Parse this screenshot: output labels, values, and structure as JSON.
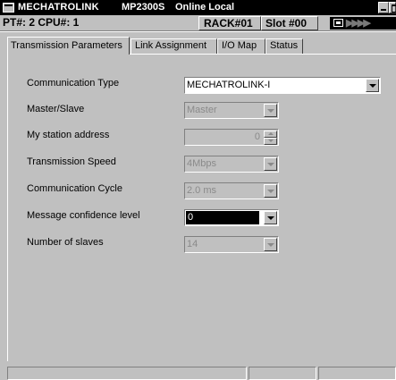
{
  "title_bar": {
    "app_name": "MECHATROLINK",
    "model": "MP2300S",
    "mode": "Online Local"
  },
  "info_bar": {
    "pt_cpu": "PT#: 2 CPU#: 1",
    "rack": "RACK#01",
    "slot": "Slot #00",
    "status_indicator": "▶▶▶▶"
  },
  "tabs": [
    {
      "label": "Transmission Parameters",
      "active": true
    },
    {
      "label": "Link Assignment",
      "active": false
    },
    {
      "label": "I/O Map",
      "active": false
    },
    {
      "label": "Status",
      "active": false
    }
  ],
  "form": {
    "communication_type": {
      "label": "Communication Type",
      "value": "MECHATROLINK-I",
      "enabled": true
    },
    "master_slave": {
      "label": "Master/Slave",
      "value": "Master",
      "enabled": false
    },
    "my_station_address": {
      "label": "My station address",
      "value": "0",
      "enabled": false
    },
    "transmission_speed": {
      "label": "Transmission Speed",
      "value": "4Mbps",
      "enabled": false
    },
    "communication_cycle": {
      "label": "Communication Cycle",
      "value": "2.0 ms",
      "enabled": false
    },
    "message_confidence_level": {
      "label": "Message confidence level",
      "value": "0",
      "enabled": true,
      "focused": true
    },
    "number_of_slaves": {
      "label": "Number of slaves",
      "value": "14",
      "enabled": false
    }
  },
  "status_bar": {
    "panes": [
      "",
      "",
      ""
    ]
  },
  "colors": {
    "title_bg": "#000000",
    "face": "#c0c0c0",
    "disabled_text": "#8a8a8a"
  }
}
